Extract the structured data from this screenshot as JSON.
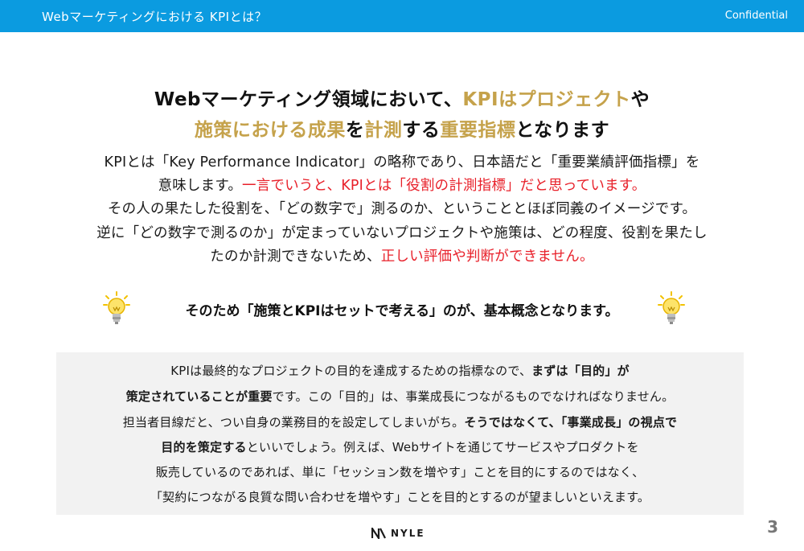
{
  "header": {
    "title": "Webマーケティングにおける KPIとは？",
    "confidential": "Confidential"
  },
  "headline": {
    "line1_a": "Webマーケティング領域において、",
    "line1_b": "KPIはプロジェクト",
    "line1_c": "や",
    "line2_a": "施策における成果",
    "line2_b": "を",
    "line2_c": "計測",
    "line2_d": "する",
    "line2_e": "重要指標",
    "line2_f": "となります"
  },
  "body": {
    "line1": "KPIとは「Key Performance Indicator」の略称であり、日本語だと「重要業績評価指標」を",
    "line2_a": "意味します。",
    "line2_b": "一言でいうと、KPIとは「役割の計測指標」だと思っています。",
    "line3": "その人の果たした役割を、「どの数字で」測るのか、ということとほぼ同義のイメージです。",
    "line4": "逆に「どの数字で測るのか」が定まっていないプロジェクトや施策は、どの程度、役割を果たし",
    "line5_a": "たのか計測できないため、",
    "line5_b": "正しい評価や判断ができません。"
  },
  "tagline": "そのため「施策とKPIはセットで考える」のが、基本概念となります。",
  "box": {
    "line1_a": "KPIは最終的なプロジェクトの目的を達成するための指標なので、",
    "line1_b": "まずは「目的」が",
    "line2_a": "策定されていることが重要",
    "line2_b": "です。この「目的」は、事業成長につながるものでなければなりません。",
    "line3_a": "担当者目線だと、つい自身の業務目的を設定してしまいがち。",
    "line3_b": "そうではなくて、「事業成長」の視点で",
    "line4_a": "目的を策定する",
    "line4_b": "といいでしょう。例えば、Webサイトを通じてサービスやプロダクトを",
    "line5": "販売しているのであれば、単に「セッション数を増やす」ことを目的にするのではなく、",
    "line6": "「契約につながる良質な問い合わせを増やす」ことを目的とするのが望ましいといえます。"
  },
  "footer": {
    "logo_text": "NYLE",
    "page_number": "3"
  },
  "colors": {
    "header_bg": "#0b9be0",
    "gold": "#c5a24b",
    "red": "#e8202a",
    "box_bg": "#f2f2f2"
  },
  "icons": [
    "lightbulb-icon",
    "nyle-logo-icon"
  ]
}
